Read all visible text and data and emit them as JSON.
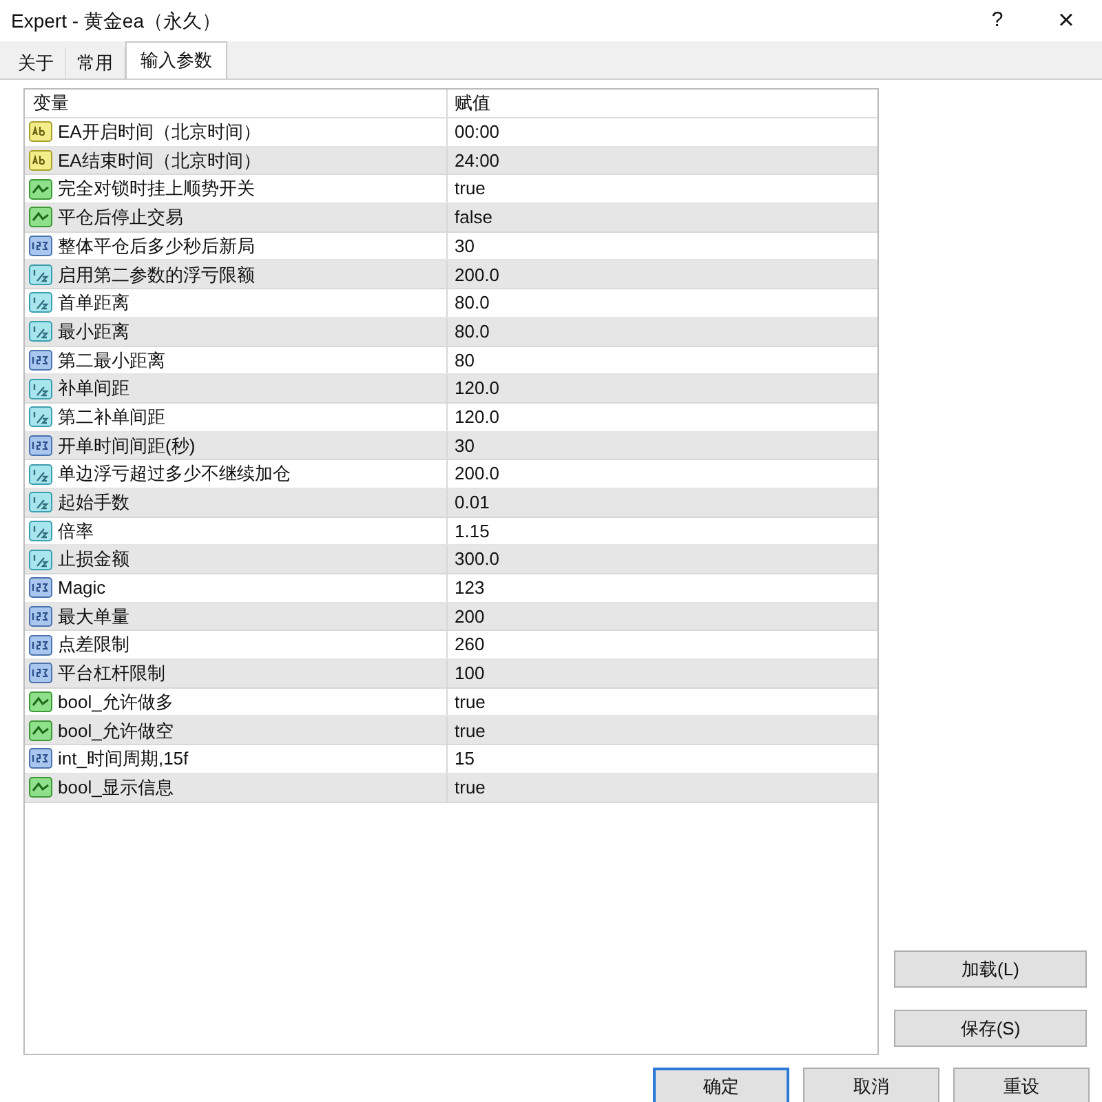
{
  "window": {
    "title": "Expert - 黄金ea（永久）",
    "help": "?",
    "close": "×"
  },
  "tabs": [
    {
      "label": "关于",
      "selected": false
    },
    {
      "label": "常用",
      "selected": false
    },
    {
      "label": "输入参数",
      "selected": true
    }
  ],
  "table": {
    "columns": [
      "变量",
      "赋值"
    ],
    "rows": [
      {
        "kind": "string",
        "name": "EA开启时间（北京时间）",
        "value": "00:00"
      },
      {
        "kind": "string",
        "name": "EA结束时间（北京时间）",
        "value": "24:00"
      },
      {
        "kind": "bool",
        "name": "完全对锁时挂上顺势开关",
        "value": "true"
      },
      {
        "kind": "bool",
        "name": "平仓后停止交易",
        "value": "false"
      },
      {
        "kind": "int",
        "name": "整体平仓后多少秒后新局",
        "value": "30"
      },
      {
        "kind": "double",
        "name": "启用第二参数的浮亏限额",
        "value": "200.0"
      },
      {
        "kind": "double",
        "name": "首单距离",
        "value": "80.0"
      },
      {
        "kind": "double",
        "name": "最小距离",
        "value": "80.0"
      },
      {
        "kind": "int",
        "name": "第二最小距离",
        "value": "80"
      },
      {
        "kind": "double",
        "name": "补单间距",
        "value": "120.0"
      },
      {
        "kind": "double",
        "name": "第二补单间距",
        "value": "120.0"
      },
      {
        "kind": "int",
        "name": "开单时间间距(秒)",
        "value": "30"
      },
      {
        "kind": "double",
        "name": "单边浮亏超过多少不继续加仓",
        "value": "200.0"
      },
      {
        "kind": "double",
        "name": "起始手数",
        "value": "0.01"
      },
      {
        "kind": "double",
        "name": "倍率",
        "value": "1.15"
      },
      {
        "kind": "double",
        "name": "止损金额",
        "value": "300.0"
      },
      {
        "kind": "int",
        "name": "Magic",
        "value": "123"
      },
      {
        "kind": "int",
        "name": "最大单量",
        "value": "200"
      },
      {
        "kind": "int",
        "name": "点差限制",
        "value": "260"
      },
      {
        "kind": "int",
        "name": "平台杠杆限制",
        "value": "100"
      },
      {
        "kind": "bool",
        "name": "bool_允许做多",
        "value": "true"
      },
      {
        "kind": "bool",
        "name": "bool_允许做空",
        "value": "true"
      },
      {
        "kind": "int",
        "name": "int_时间周期,15f",
        "value": "15"
      },
      {
        "kind": "bool",
        "name": "bool_显示信息",
        "value": "true"
      }
    ]
  },
  "side_buttons": [
    {
      "label": "加载(L)"
    },
    {
      "label": "保存(S)"
    }
  ],
  "footer_buttons": [
    {
      "label": "确定",
      "kind": "default"
    },
    {
      "label": "取消",
      "kind": "normal"
    },
    {
      "label": "重设",
      "kind": "normal"
    }
  ]
}
